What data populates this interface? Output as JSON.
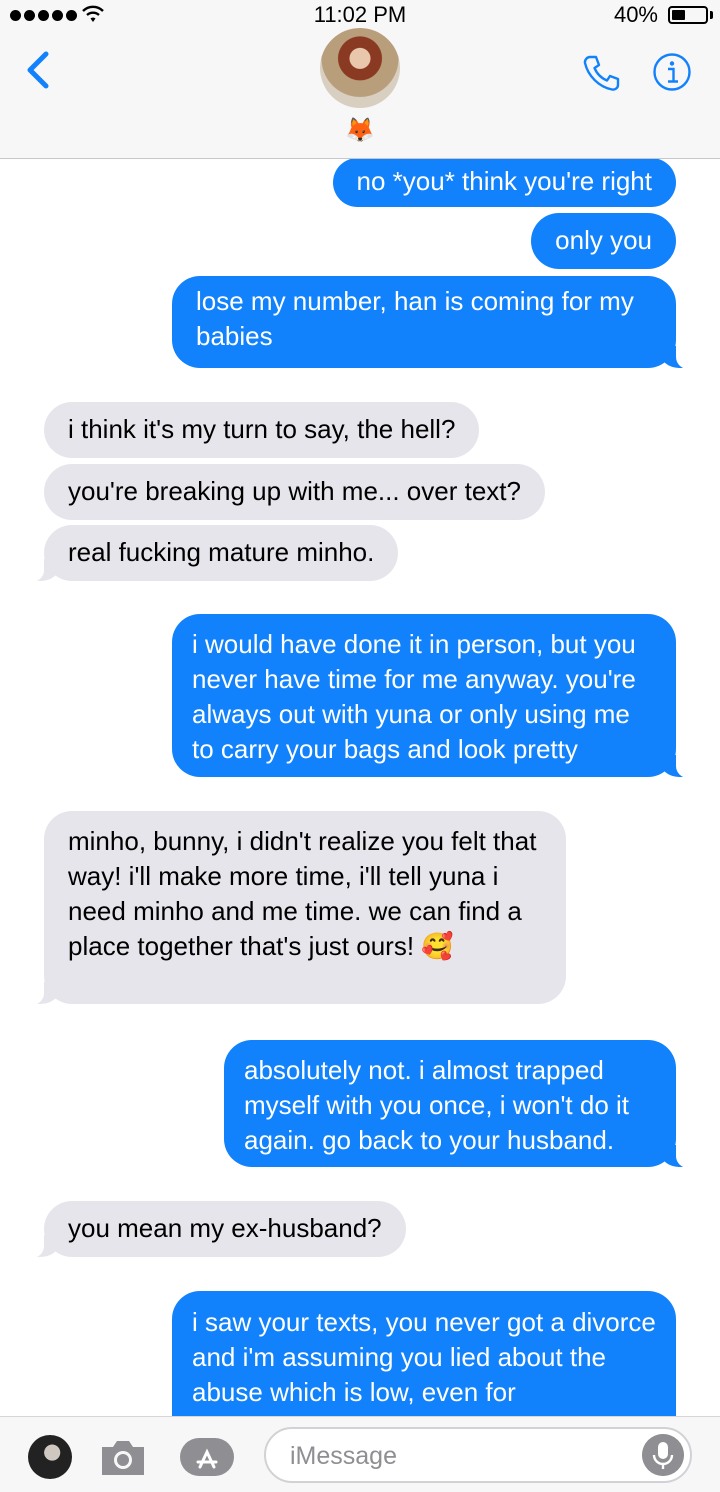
{
  "status_bar": {
    "time": "11:02 PM",
    "battery_percent": "40%",
    "battery_level": 0.4
  },
  "contact": {
    "avatar_icon": "contact-avatar-photo",
    "emoji": "🦊"
  },
  "header_icons": {
    "back": "chevron-left-icon",
    "call": "phone-icon",
    "info": "info-icon"
  },
  "colors": {
    "sent_bubble": "#1282fc",
    "received_bubble": "#e6e5eb",
    "accent": "#1282fc"
  },
  "messages": [
    {
      "direction": "sent",
      "text": "no *you* think you're right"
    },
    {
      "direction": "sent",
      "text": "only you"
    },
    {
      "direction": "sent",
      "text": "lose my number, han is coming for my babies"
    },
    {
      "direction": "received",
      "text": "i think it's my turn to say, the hell?"
    },
    {
      "direction": "received",
      "text": "you're breaking up with me... over text?"
    },
    {
      "direction": "received",
      "text": "real fucking mature minho."
    },
    {
      "direction": "sent",
      "text": "i would have done it in person, but you never have time for me anyway. you're always out with yuna or only using me to carry your bags and look pretty"
    },
    {
      "direction": "received",
      "text": "minho, bunny, i didn't realize you felt that way! i'll make more time, i'll tell yuna i need minho and me time. we can find a place together that's just ours! 🥰"
    },
    {
      "direction": "sent",
      "text": "absolutely not. i almost trapped myself with you once, i won't do it again. go back to your husband."
    },
    {
      "direction": "received",
      "text": "you mean my ex-husband?"
    },
    {
      "direction": "sent",
      "text": "i saw your texts, you never got a divorce and i'm assuming you lied about the abuse which is low, even for"
    }
  ],
  "input_bar": {
    "placeholder": "iMessage",
    "icons": [
      "memoji-avatar-icon",
      "camera-icon",
      "app-store-icon",
      "microphone-icon"
    ]
  }
}
